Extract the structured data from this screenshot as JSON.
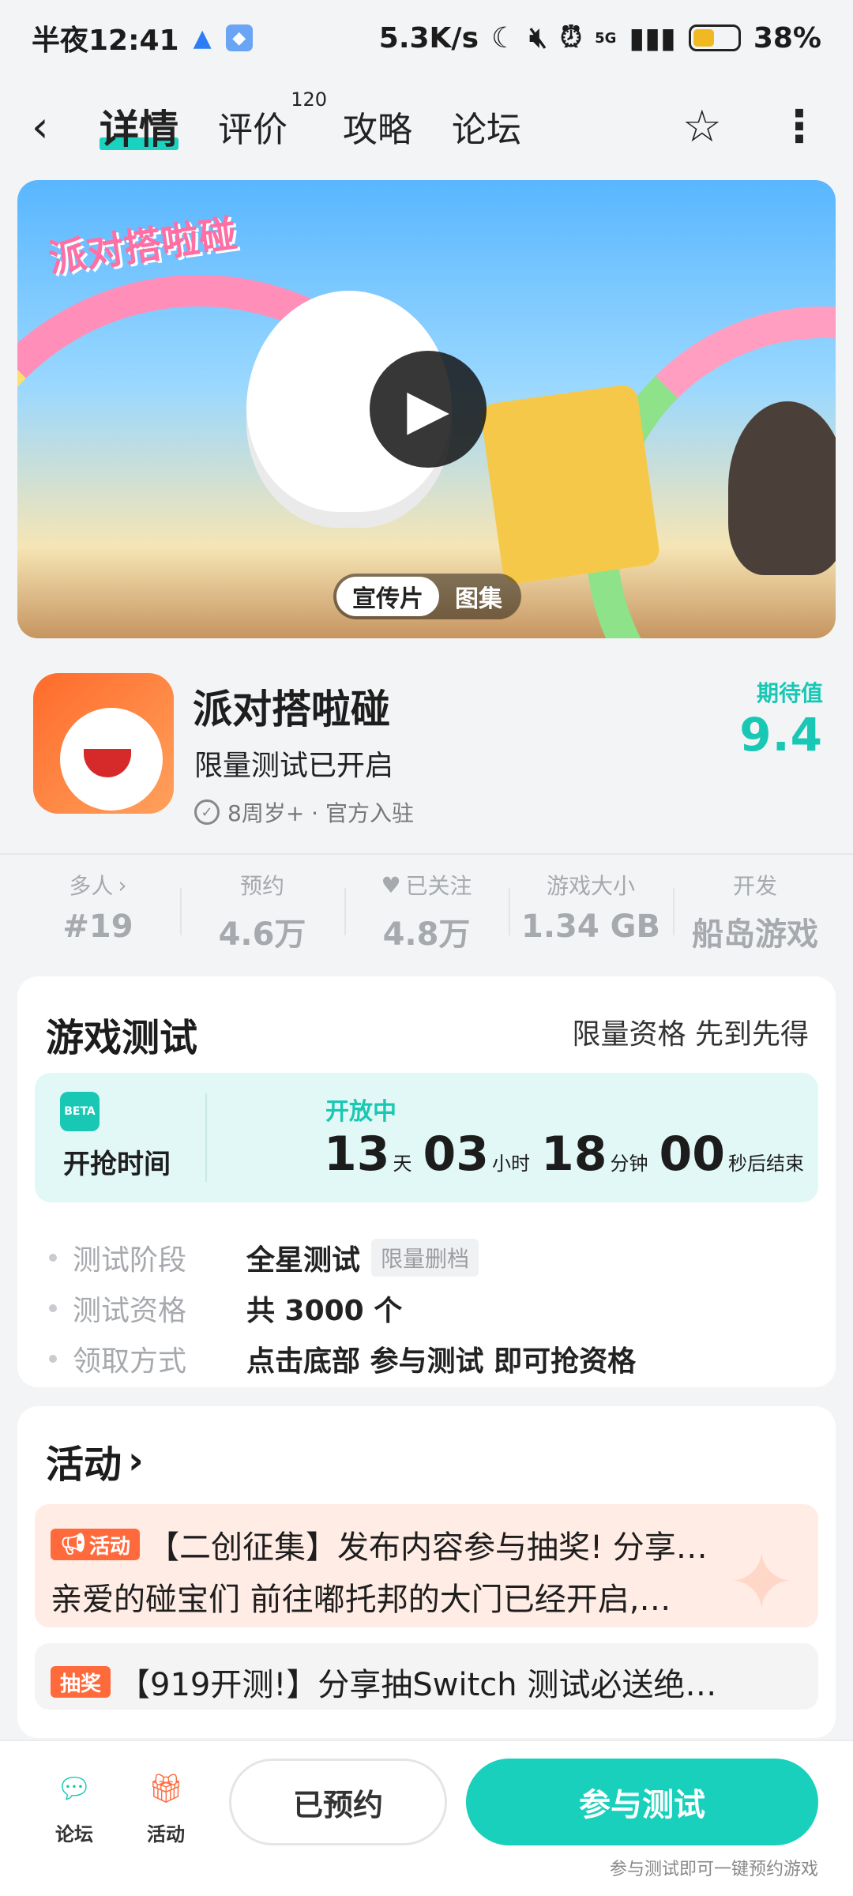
{
  "status_bar": {
    "time": "半夜12:41",
    "net_speed": "5.3K/s",
    "network": "5G",
    "battery": "38%"
  },
  "nav": {
    "tabs": [
      {
        "label": "详情",
        "badge": ""
      },
      {
        "label": "评价",
        "badge": "120"
      },
      {
        "label": "攻略",
        "badge": ""
      },
      {
        "label": "论坛",
        "badge": ""
      }
    ]
  },
  "hero": {
    "logo_text": "派对搭啦碰",
    "tabs": [
      "宣传片",
      "图集"
    ],
    "active_tab": "宣传片"
  },
  "game": {
    "name": "派对搭啦碰",
    "status": "限量测试已开启",
    "meta": "8周岁+ · 官方入驻",
    "expect_label": "期待值",
    "expect_value": "9.4"
  },
  "stats": [
    {
      "label": "多人",
      "value": "#19",
      "icon": "chevron-right-icon"
    },
    {
      "label": "预约",
      "value": "4.6万",
      "icon": ""
    },
    {
      "label": "已关注",
      "value": "4.8万",
      "icon": "heart-icon"
    },
    {
      "label": "游戏大小",
      "value": "1.34 GB",
      "icon": ""
    },
    {
      "label": "开发",
      "value": "船岛游戏",
      "icon": ""
    }
  ],
  "test": {
    "title": "游戏测试",
    "subtitle": "限量资格 先到先得",
    "beta_label": "BETA",
    "grab_label": "开抢时间",
    "open_label": "开放中",
    "countdown": {
      "days": "13",
      "days_unit": "天",
      "hours": "03",
      "hours_unit": "小时",
      "minutes": "18",
      "minutes_unit": "分钟",
      "seconds": "00",
      "seconds_unit": "秒后结束"
    },
    "rows": [
      {
        "key": "测试阶段",
        "value": "全星测试",
        "tag": "限量删档"
      },
      {
        "key": "测试资格",
        "value": "共 3000 个",
        "tag": ""
      },
      {
        "key": "领取方式",
        "value": "点击底部 参与测试 即可抢资格",
        "tag": ""
      }
    ]
  },
  "activity": {
    "title": "活动",
    "items": [
      {
        "badge": "活动",
        "title": "【二创征集】发布内容参与抽奖! 分享…",
        "desc": "亲爱的碰宝们 前往嘟托邦的大门已经开启,…"
      },
      {
        "badge": "抽奖",
        "title": "【919开测!】分享抽Switch 测试必送绝…",
        "desc": ""
      }
    ]
  },
  "bottom_bar": {
    "forum_label": "论坛",
    "activity_label": "活动",
    "reserved_label": "已预约",
    "join_label": "参与测试",
    "join_tip": "参与测试即可一键预约游戏"
  },
  "colors": {
    "accent": "#19d3c0",
    "activity_badge": "#ff6a3d"
  }
}
